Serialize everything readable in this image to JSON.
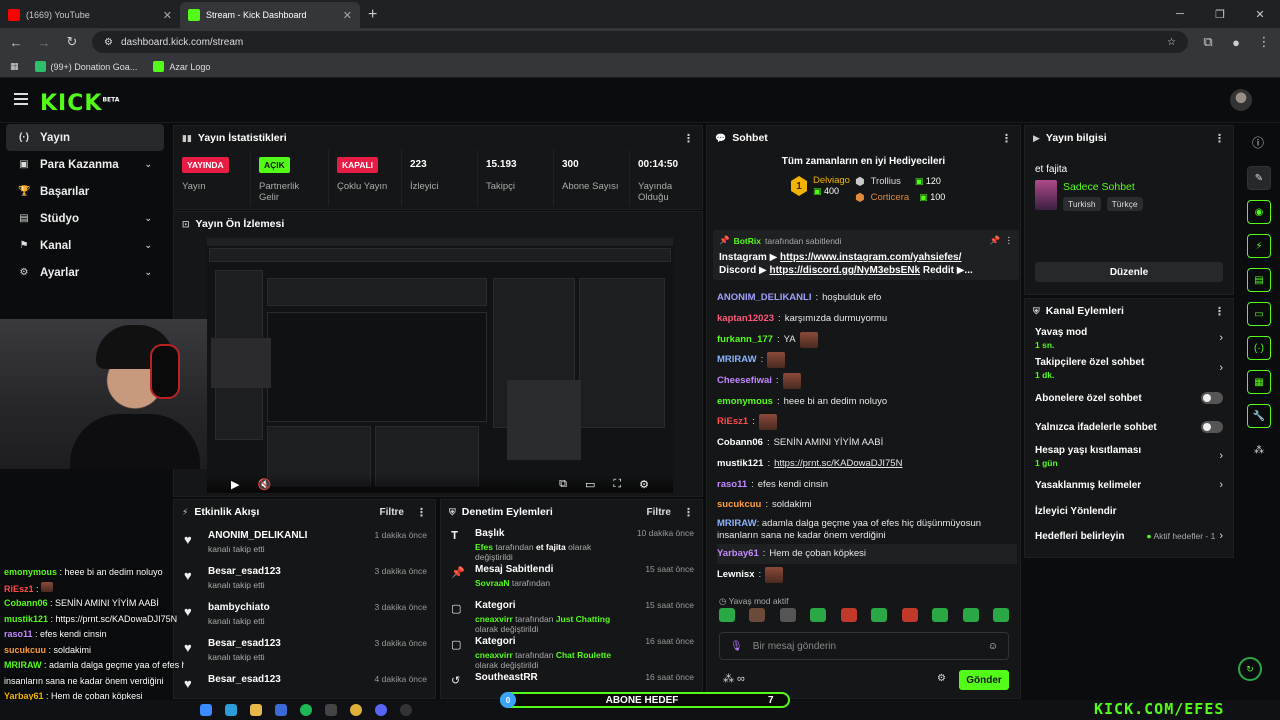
{
  "browser": {
    "tabs": [
      {
        "label": "(1669) YouTube",
        "color": "#ff0000"
      },
      {
        "label": "Stream - Kick Dashboard",
        "color": "#53fc18"
      }
    ],
    "url": "dashboard.kick.com/stream",
    "bookmarks": [
      {
        "label": "(99+) Donation Goa...",
        "color": "#2dbf6b"
      },
      {
        "label": "Azar Logo",
        "color": "#53fc18"
      }
    ]
  },
  "header": {
    "logo": "KICK",
    "logo_sup": "BETA"
  },
  "sidebar": {
    "items": [
      {
        "icon": "(·)",
        "label": "Yayın"
      },
      {
        "icon": "▣",
        "label": "Para Kazanma",
        "chev": "⌄"
      },
      {
        "icon": "🏆",
        "label": "Başarılar"
      },
      {
        "icon": "▤",
        "label": "Stüdyo",
        "chev": "⌄"
      },
      {
        "icon": "⚑",
        "label": "Kanal",
        "chev": "⌄"
      },
      {
        "icon": "⚙",
        "label": "Ayarlar",
        "chev": "⌄"
      }
    ]
  },
  "stats_panel": {
    "title": "Yayın İstatistikleri",
    "stats": [
      {
        "value": "YAYINDA",
        "label": "Yayın"
      },
      {
        "value": "AÇIK",
        "label": "Partnerlik Gelir"
      },
      {
        "value": "KAPALI",
        "label": "Çoklu Yayın"
      },
      {
        "value": "223",
        "label": "İzleyici"
      },
      {
        "value": "15.193",
        "label": "Takipçi"
      },
      {
        "value": "300",
        "label": "Abone Sayısı"
      },
      {
        "value": "00:14:50",
        "label": "Yayında Olduğu"
      }
    ]
  },
  "preview_panel": {
    "title": "Yayın Ön İzlemesi"
  },
  "activity_panel": {
    "title": "Etkinlik Akışı",
    "filter": "Filtre",
    "items": [
      {
        "name": "ANONIM_DELIKANLI",
        "sub": "kanalı takip etti",
        "time": "1 dakika önce"
      },
      {
        "name": "Besar_esad123",
        "sub": "kanalı takip etti",
        "time": "3 dakika önce"
      },
      {
        "name": "bambychiato",
        "sub": "kanalı takip etti",
        "time": "3 dakika önce"
      },
      {
        "name": "Besar_esad123",
        "sub": "kanalı takip etti",
        "time": "3 dakika önce"
      },
      {
        "name": "Besar_esad123",
        "sub": "",
        "time": "4 dakika önce"
      }
    ]
  },
  "mod_panel": {
    "title": "Denetim Eylemleri",
    "filter": "Filtre",
    "items": [
      {
        "icon": "𝐓",
        "name": "Başlık",
        "user": "Efes",
        "mid": " tarafından ",
        "target": "et fajita",
        "end": " olarak değiştirildi",
        "time": "10 dakika önce"
      },
      {
        "icon": "📌",
        "name": "Mesaj Sabitlendi",
        "user": "SovraaN",
        "mid": " tarafından",
        "target": "",
        "end": "",
        "time": "15 saat önce"
      },
      {
        "icon": "▢",
        "name": "Kategori",
        "user": "cneaxvirr",
        "mid": " tarafından ",
        "target": "Just Chatting",
        "end": " olarak değiştirildi",
        "time": "15 saat önce"
      },
      {
        "icon": "▢",
        "name": "Kategori",
        "user": "cneaxvirr",
        "mid": " tarafından ",
        "target": "Chat Roulette",
        "end": " olarak değiştirildi",
        "time": "16 saat önce"
      },
      {
        "icon": "↺",
        "name": "SoutheastRR",
        "user": "",
        "mid": "",
        "target": "",
        "end": "",
        "time": "16 saat önce"
      }
    ]
  },
  "chat_panel": {
    "title": "Sohbet",
    "gifters_title": "Tüm zamanların en iyi Hediyecileri",
    "gifters": [
      {
        "rank": "1",
        "name": "Delviago",
        "value": "400",
        "color": "#f2b400"
      },
      {
        "rank": "",
        "name": "Trollius",
        "value": "120",
        "color": "#c9c9c9"
      },
      {
        "rank": "",
        "name": "Corticera",
        "value": "100",
        "color": "#e08a3a"
      }
    ],
    "pinned_by": "BotRix",
    "pinned_by_suffix": "tarafından sabitlendi",
    "pinned_line1_label": "Instagram ▶ ",
    "pinned_line1_link": "https://www.instagram.com/yahsiefes/",
    "pinned_line2_label": "Discord ▶ ",
    "pinned_line2_link": "https://discord.gg/NyM3ebsENk",
    "pinned_line2_rest": " Reddit ▶...",
    "messages": [
      {
        "user": "ANONIM_DELIKANLI",
        "color": "#a0a0ff",
        "text": "hoşbulduk efo",
        "emote": false
      },
      {
        "user": "kaptan12023",
        "color": "#ff5a7a",
        "text": "karşımızda durmuyormu",
        "emote": false
      },
      {
        "user": "furkann_177",
        "color": "#53fc18",
        "text": "YA",
        "emote": true
      },
      {
        "user": "MRIRAW",
        "color": "#8ab4ff",
        "text": "",
        "emote": true
      },
      {
        "user": "Cheesefiwai",
        "color": "#c58aff",
        "text": "",
        "emote": true
      },
      {
        "user": "emonymous",
        "color": "#53fc18",
        "text": "heee bi an dedim noluyo",
        "emote": false
      },
      {
        "user": "RiEsz1",
        "color": "#ff4d4d",
        "text": "",
        "emote": true
      },
      {
        "user": "Cobann06",
        "color": "#ffffff",
        "text": "SENİN AMINI YİYİM AABİ",
        "emote": false
      },
      {
        "user": "mustik121",
        "color": "#ffffff",
        "text": "https://prnt.sc/KADowaDJI75N",
        "emote": false
      },
      {
        "user": "raso11",
        "color": "#c58aff",
        "text": "efes kendi cinsin",
        "emote": false
      },
      {
        "user": "sucukcuu",
        "color": "#ff9f3a",
        "text": "soldakimi",
        "emote": false
      },
      {
        "user": "MRIRAW",
        "color": "#8ab4ff",
        "text": "adamla dalga geçme yaa of efes hiç düşünmüyosun insanların sana ne kadar önem verdiğini",
        "emote": false
      },
      {
        "user": "Yarbay61",
        "color": "#c58aff",
        "text": "Hem de çoban köpkesi",
        "emote": false
      },
      {
        "user": "Lewnisx",
        "color": "#ffffff",
        "text": "",
        "emote": true
      }
    ],
    "slow_mode": "Yavaş mod aktif",
    "input_placeholder": "Bir mesaj gönderin",
    "send_label": "Gönder"
  },
  "info_panel": {
    "title": "Yayın bilgisi",
    "stream_title": "et fajita",
    "category": "Sadece Sohbet",
    "tags": [
      "Turkish",
      "Türkçe"
    ],
    "edit_label": "Düzenle"
  },
  "channel_actions": {
    "title": "Kanal Eylemleri",
    "rows": [
      {
        "title": "Yavaş mod",
        "sub": "1 sn.",
        "control": "chev"
      },
      {
        "title": "Takipçilere özel sohbet",
        "sub": "1 dk.",
        "control": "chev"
      },
      {
        "title": "Abonelere özel sohbet",
        "sub": "",
        "control": "toggle"
      },
      {
        "title": "Yalnızca ifadelerle sohbet",
        "sub": "",
        "control": "toggle"
      },
      {
        "title": "Hesap yaşı kısıtlaması",
        "sub": "1 gün",
        "control": "chev"
      },
      {
        "title": "Yasaklanmış kelimeler",
        "sub": "",
        "control": "chev"
      },
      {
        "title": "İzleyici Yönlendir",
        "sub": "",
        "control": "none"
      },
      {
        "title": "Hedefleri belirleyin",
        "sub": "",
        "control": "goal",
        "extra": "Aktif hedefler - 1"
      }
    ]
  },
  "overlay_chat": [
    {
      "user": "emonymous",
      "color": "#53fc18",
      "text": " : heee bi an dedim noluyo"
    },
    {
      "user": "RiEsz1",
      "color": "#ff4d4d",
      "text": " : "
    },
    {
      "user": "Cobann06",
      "color": "#53fc18",
      "text": " : SENİN AMINI YİYİM AABİ"
    },
    {
      "user": "mustik121",
      "color": "#53fc18",
      "text": " : https://prnt.sc/KADowaDJI75N"
    },
    {
      "user": "raso11",
      "color": "#c58aff",
      "text": " : efes kendi cinsin"
    },
    {
      "user": "sucukcuu",
      "color": "#ff9f3a",
      "text": " : soldakimi"
    },
    {
      "user": "MRIRAW",
      "color": "#53fc18",
      "text": " : adamla dalga geçme yaa of efes hiç düşünmüyosun"
    },
    {
      "user": "",
      "color": "#ffffff",
      "text": "insanların sana ne kadar önem verdiğini"
    },
    {
      "user": "Yarbay61",
      "color": "#f2b400",
      "text": " : Hem de çoban köpkesi"
    }
  ],
  "goal_bar": {
    "start": "0",
    "label": "ABONE HEDEF",
    "target": "7"
  },
  "watermark": "KICK.COM/EFES"
}
